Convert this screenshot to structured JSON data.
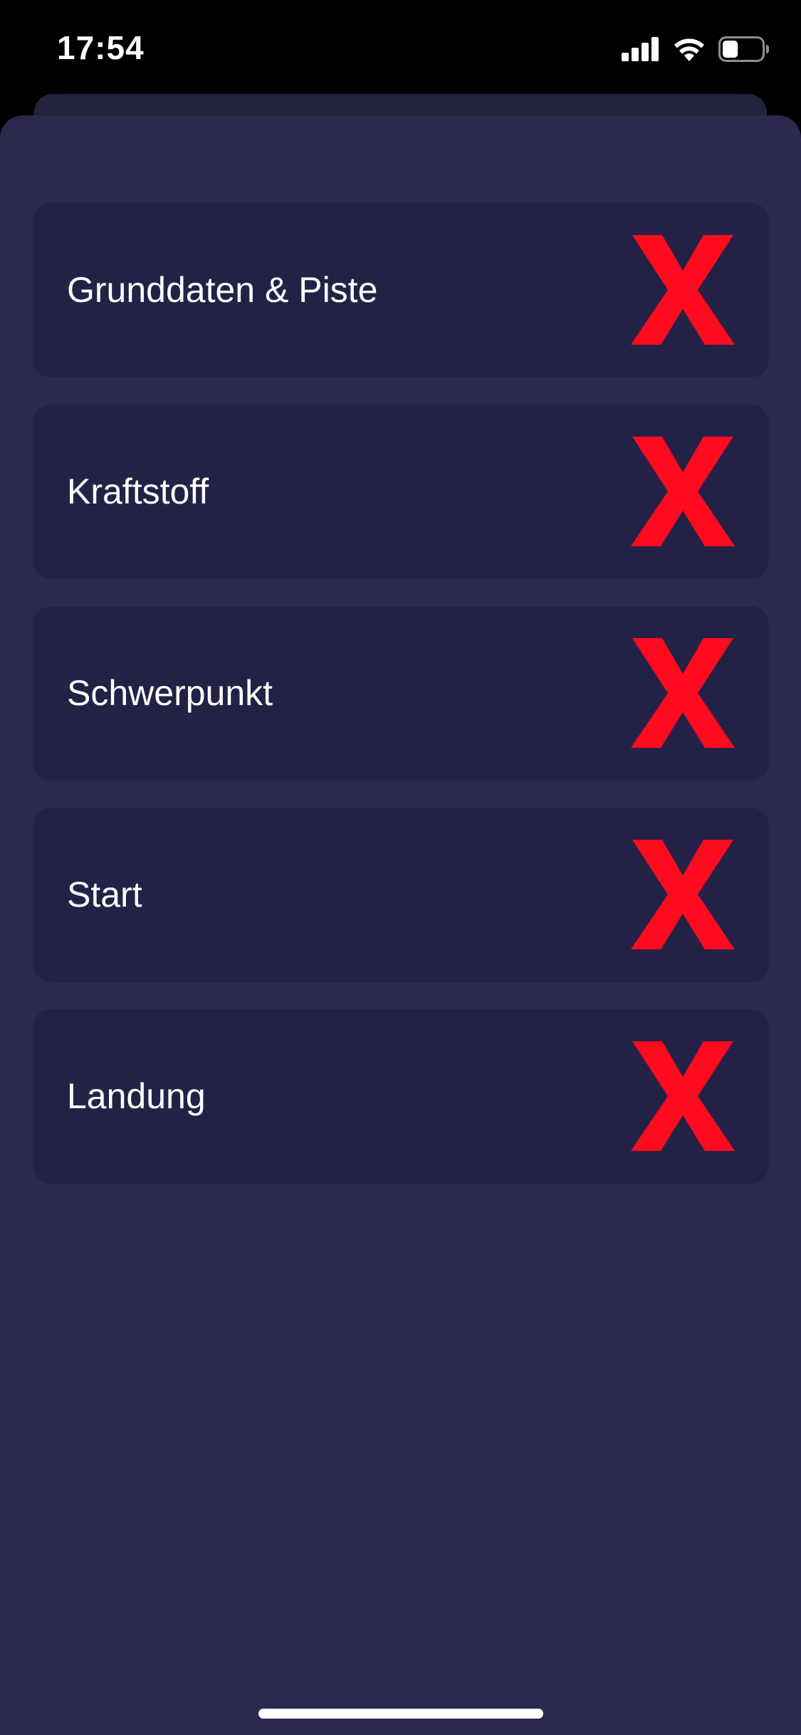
{
  "status_bar": {
    "time": "17:54",
    "icons": [
      "cellular-signal-icon",
      "wifi-icon",
      "battery-icon"
    ],
    "battery_level": 0.4
  },
  "colors": {
    "background": "#000000",
    "sheet": "#2b294d",
    "card": "#232246",
    "status_mark": "#ff0a1f",
    "text": "#ffffff"
  },
  "checklist": {
    "items": [
      {
        "label": "Grunddaten & Piste",
        "status": "incomplete",
        "status_icon": "red-x-icon"
      },
      {
        "label": "Kraftstoff",
        "status": "incomplete",
        "status_icon": "red-x-icon"
      },
      {
        "label": "Schwerpunkt",
        "status": "incomplete",
        "status_icon": "red-x-icon"
      },
      {
        "label": "Start",
        "status": "incomplete",
        "status_icon": "red-x-icon"
      },
      {
        "label": "Landung",
        "status": "incomplete",
        "status_icon": "red-x-icon"
      }
    ]
  }
}
